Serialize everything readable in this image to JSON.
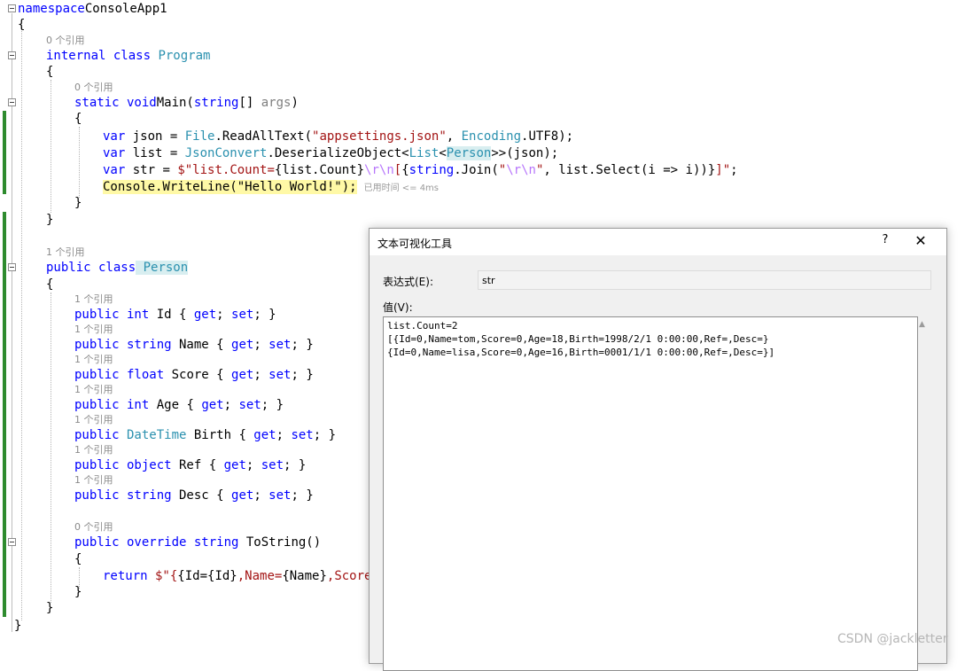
{
  "editor": {
    "lines": [
      {
        "segs": [
          [
            "kw",
            "namespace"
          ],
          [
            "",
            "ConsoleApp1"
          ]
        ]
      },
      {
        "segs": [
          [
            "",
            "{"
          ]
        ]
      },
      {
        "segs": [
          [
            "kw",
            "internal class"
          ],
          [
            "ty",
            "Program"
          ]
        ]
      },
      {
        "segs": [
          [
            "",
            "{"
          ]
        ]
      },
      {
        "segs": [
          [
            "kw",
            "static void"
          ],
          [
            "",
            "Main("
          ],
          [
            "kw",
            "string"
          ],
          [
            "",
            "[] "
          ],
          [
            "param",
            "args"
          ],
          [
            "",
            ")"
          ]
        ]
      },
      {
        "segs": [
          [
            "",
            "{"
          ]
        ]
      },
      {
        "segs": [
          [
            "kw",
            "var"
          ],
          [
            "",
            " json = "
          ],
          [
            "ty",
            "File"
          ],
          [
            "",
            ".ReadAllText("
          ],
          [
            "str",
            "\"appsettings.json\""
          ],
          [
            "",
            ", "
          ],
          [
            "ty",
            "Encoding"
          ],
          [
            "",
            ".UTF8);"
          ]
        ]
      },
      {
        "segs": [
          [
            "kw",
            "var"
          ],
          [
            "",
            " list = "
          ],
          [
            "ty",
            "JsonConvert"
          ],
          [
            "",
            ".DeserializeObject<"
          ],
          [
            "ty",
            "List"
          ],
          [
            "",
            "<"
          ],
          [
            "ty-hl",
            "Person"
          ],
          [
            "",
            ">>(json);"
          ]
        ]
      },
      {
        "segs": [
          [
            "kw",
            "var"
          ],
          [
            "",
            " str = "
          ],
          [
            "str",
            "$\"list.Count="
          ],
          [
            "",
            "{list.Count}"
          ],
          [
            "esc",
            "\\r\\n"
          ],
          [
            "str",
            "["
          ],
          [
            "",
            "{"
          ],
          [
            "kw",
            "string"
          ],
          [
            "",
            ".Join("
          ],
          [
            "str",
            "\""
          ],
          [
            "esc",
            "\\r\\n"
          ],
          [
            "str",
            "\""
          ],
          [
            "",
            ", list.Select(i => i))}"
          ],
          [
            "str",
            "]\""
          ],
          [
            "",
            ";"
          ]
        ]
      },
      {
        "segs": [
          [
            "hl",
            "Console.WriteLine(\"Hello World!\");"
          ]
        ],
        "perf": "已用时间 <= 4ms"
      },
      {
        "segs": [
          [
            "",
            "}"
          ]
        ]
      },
      {
        "segs": [
          [
            "",
            "}"
          ]
        ]
      },
      {
        "segs": [
          [
            "kw",
            "public class"
          ],
          [
            "ty-hl",
            "Person"
          ]
        ]
      },
      {
        "segs": [
          [
            "",
            "{"
          ]
        ]
      },
      {
        "segs": [
          [
            "kw",
            "public int"
          ],
          [
            "",
            " Id { "
          ],
          [
            "kw",
            "get"
          ],
          [
            "",
            "; "
          ],
          [
            "kw",
            "set"
          ],
          [
            "",
            "; }"
          ]
        ]
      },
      {
        "segs": [
          [
            "kw",
            "public string"
          ],
          [
            "",
            " Name { "
          ],
          [
            "kw",
            "get"
          ],
          [
            "",
            "; "
          ],
          [
            "kw",
            "set"
          ],
          [
            "",
            "; }"
          ]
        ]
      },
      {
        "segs": [
          [
            "kw",
            "public float"
          ],
          [
            "",
            " Score { "
          ],
          [
            "kw",
            "get"
          ],
          [
            "",
            "; "
          ],
          [
            "kw",
            "set"
          ],
          [
            "",
            "; }"
          ]
        ]
      },
      {
        "segs": [
          [
            "kw",
            "public int"
          ],
          [
            "",
            " Age { "
          ],
          [
            "kw",
            "get"
          ],
          [
            "",
            "; "
          ],
          [
            "kw",
            "set"
          ],
          [
            "",
            "; }"
          ]
        ]
      },
      {
        "segs": [
          [
            "kw",
            "public"
          ],
          [
            "ty",
            "DateTime"
          ],
          [
            "",
            " Birth { "
          ],
          [
            "kw",
            "get"
          ],
          [
            "",
            "; "
          ],
          [
            "kw",
            "set"
          ],
          [
            "",
            "; }"
          ]
        ]
      },
      {
        "segs": [
          [
            "kw",
            "public object"
          ],
          [
            "",
            " Ref { "
          ],
          [
            "kw",
            "get"
          ],
          [
            "",
            "; "
          ],
          [
            "kw",
            "set"
          ],
          [
            "",
            "; }"
          ]
        ]
      },
      {
        "segs": [
          [
            "kw",
            "public string"
          ],
          [
            "",
            " Desc { "
          ],
          [
            "kw",
            "get"
          ],
          [
            "",
            "; "
          ],
          [
            "kw",
            "set"
          ],
          [
            "",
            "; }"
          ]
        ]
      },
      {
        "segs": [
          [
            "kw",
            "public override string"
          ],
          [
            "",
            " ToString()"
          ]
        ]
      },
      {
        "segs": [
          [
            "",
            "{"
          ]
        ]
      },
      {
        "segs": [
          [
            "kw",
            "return"
          ],
          [
            "str",
            " $\"{"
          ],
          [
            "",
            "{Id="
          ],
          [
            "",
            "{Id}"
          ],
          [
            "str",
            ",Name="
          ],
          [
            "",
            "{Name}"
          ],
          [
            "str",
            ",Score="
          ]
        ]
      },
      {
        "segs": [
          [
            "",
            "}"
          ]
        ]
      },
      {
        "segs": [
          [
            "",
            "}"
          ]
        ]
      },
      {
        "segs": [
          [
            "",
            "}"
          ]
        ]
      }
    ],
    "lens": [
      "0 个引用",
      "0 个引用",
      "1 个引用",
      "1 个引用",
      "1 个引用",
      "1 个引用",
      "1 个引用",
      "1 个引用",
      "1 个引用",
      "1 个引用",
      "0 个引用"
    ]
  },
  "dialog": {
    "title": "文本可视化工具",
    "help": "?",
    "close": "✕",
    "expression_label": "表达式(E):",
    "expression_value": "str",
    "value_label": "值(V):",
    "value_lines": [
      "list.Count=2",
      "[{Id=0,Name=tom,Score=0,Age=18,Birth=1998/2/1 0:00:00,Ref=,Desc=}",
      "{Id=0,Name=lisa,Score=0,Age=16,Birth=0001/1/1 0:00:00,Ref=,Desc=}]"
    ],
    "scroll_up_icon": "triangle-up-icon"
  },
  "watermark": "CSDN @jackletter",
  "colors": {
    "keyword": "#0000ff",
    "type": "#2b91af",
    "string": "#a31515",
    "gutter_change": "#2e8b2e"
  }
}
